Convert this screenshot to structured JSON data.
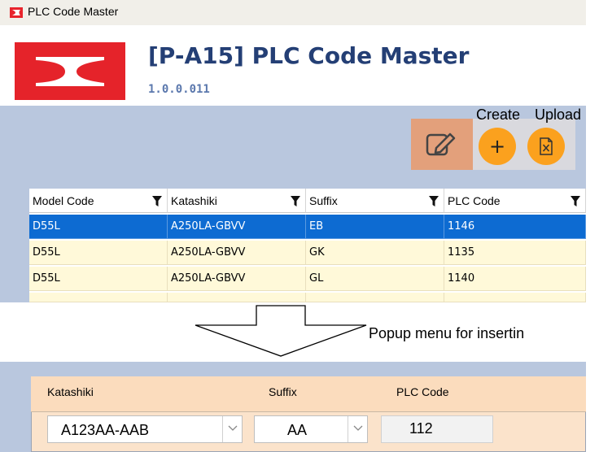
{
  "window": {
    "title": "PLC Code Master"
  },
  "header": {
    "title": "[P-A15] PLC Code Master",
    "version": "1.0.0.011"
  },
  "toolbar": {
    "create_label": "Create",
    "upload_label": "Upload",
    "create_symbol": "+",
    "edit_icon": "edit-icon",
    "upload_icon": "excel-file-icon"
  },
  "grid": {
    "columns": [
      "Model Code",
      "Katashiki",
      "Suffix",
      "PLC Code"
    ],
    "rows": [
      [
        "D55L",
        "A250LA-GBVV",
        "EB",
        "1146"
      ],
      [
        "D55L",
        "A250LA-GBVV",
        "GK",
        "1135"
      ],
      [
        "D55L",
        "A250LA-GBVV",
        "GL",
        "1140"
      ]
    ],
    "selected_row": 0
  },
  "annotation": {
    "note": "Popup menu for insertin"
  },
  "popup": {
    "headers": {
      "katashiki": "Katashiki",
      "suffix": "Suffix",
      "plc_code": "PLC Code"
    },
    "katashiki_value": "A123AA-AAB",
    "suffix_value": "AA",
    "plc_code_value": "112"
  },
  "colors": {
    "brand_red": "#e5232a",
    "title_blue": "#243f75",
    "selected_row": "#0d6bd2",
    "row_background": "#fff9d9",
    "action_orange": "#fba11e",
    "panel_blue": "#b9c7de"
  }
}
